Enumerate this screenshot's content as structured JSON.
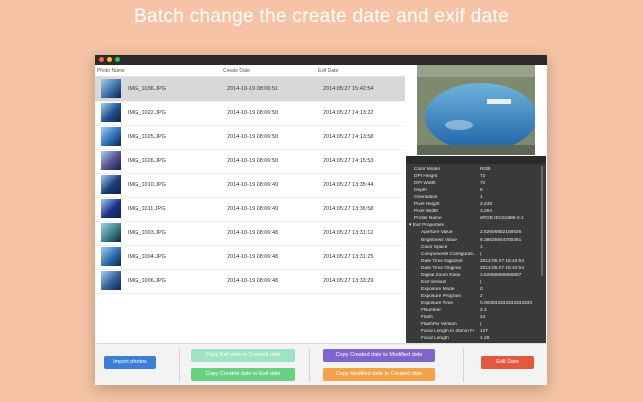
{
  "headline": "Batch change the create date and exif date",
  "table": {
    "headers": {
      "name": "Photo Name",
      "create": "Create Date",
      "exif": "Exif Date"
    },
    "rows": [
      {
        "name": "IMG_1036.JPG",
        "create": "2014-10-19 08:06:51",
        "exif": "2014:05:27 15:42:54",
        "thumb_color": "#3a6fa8"
      },
      {
        "name": "IMG_1022.JPG",
        "create": "2014-10-19 08:06:50",
        "exif": "2014:05:27 14:13:22",
        "thumb_color": "#1f4f8f"
      },
      {
        "name": "IMG_1025.JPG",
        "create": "2014-10-19 08:06:50",
        "exif": "2014:05:27 14:13:58",
        "thumb_color": "#2a70b8"
      },
      {
        "name": "IMG_1026.JPG",
        "create": "2014-10-19 08:06:50",
        "exif": "2014:05:27 14:15:53",
        "thumb_color": "#5a4e8f"
      },
      {
        "name": "IMG_1010.JPG",
        "create": "2014-10-19 08:06:49",
        "exif": "2014:05:27 13:35:44",
        "thumb_color": "#1a3c7a"
      },
      {
        "name": "IMG_1011.JPG",
        "create": "2014-10-19 08:06:49",
        "exif": "2014:05:27 13:36:58",
        "thumb_color": "#1b2f8c"
      },
      {
        "name": "IMG_1003.JPG",
        "create": "2014-10-19 08:06:48",
        "exif": "2014:05:27 13:31:12",
        "thumb_color": "#3b7f86"
      },
      {
        "name": "IMG_1004.JPG",
        "create": "2014-10-19 08:06:48",
        "exif": "2014:05:27 13:31:25",
        "thumb_color": "#2b6fae"
      },
      {
        "name": "IMG_1006.JPG",
        "create": "2014-10-19 08:06:48",
        "exif": "2014:05:27 13:33:29",
        "thumb_color": "#355f98"
      }
    ]
  },
  "props": [
    {
      "k": "Color Model",
      "v": "RGB",
      "indent": 0
    },
    {
      "k": "DPI Height",
      "v": "72",
      "indent": 0
    },
    {
      "k": "DPI Width",
      "v": "72",
      "indent": 0
    },
    {
      "k": "Depth",
      "v": "8",
      "indent": 0
    },
    {
      "k": "Orientation",
      "v": "1",
      "indent": 0
    },
    {
      "k": "Pixel Height",
      "v": "2,448",
      "indent": 0
    },
    {
      "k": "Pixel Width",
      "v": "3,264",
      "indent": 0
    },
    {
      "k": "Profile Name",
      "v": "sRGB IEC61966-2.1",
      "indent": 0
    },
    {
      "k": "▾ Exif Properties",
      "v": "",
      "indent": -1
    },
    {
      "k": "Aperture Value",
      "v": "2.52606882168926",
      "indent": 1
    },
    {
      "k": "Brightness Value",
      "v": "9.38635944700461",
      "indent": 1
    },
    {
      "k": "Color Space",
      "v": "1",
      "indent": 1
    },
    {
      "k": "Components Configurati...",
      "v": "(",
      "indent": 1
    },
    {
      "k": "Date Time Digitized",
      "v": "2014:05:27 15:42:54",
      "indent": 1
    },
    {
      "k": "Date Time Original",
      "v": "2014:05:27 15:42:54",
      "indent": 1
    },
    {
      "k": "Digital Zoom Ratio",
      "v": "3.62666666666667",
      "indent": 1
    },
    {
      "k": "Exif Version",
      "v": "(",
      "indent": 1
    },
    {
      "k": "Exposure Mode",
      "v": "0",
      "indent": 1
    },
    {
      "k": "Exposure Program",
      "v": "2",
      "indent": 1
    },
    {
      "k": "Exposure Time",
      "v": "0.000833333333333333",
      "indent": 1
    },
    {
      "k": "FNumber",
      "v": "2.4",
      "indent": 1
    },
    {
      "k": "Flash",
      "v": "24",
      "indent": 1
    },
    {
      "k": "FlashPix Version",
      "v": "(",
      "indent": 1
    },
    {
      "k": "Focal Length In 35mm Fi",
      "v": "127",
      "indent": 1
    },
    {
      "k": "Focal Length",
      "v": "4.28",
      "indent": 1
    }
  ],
  "buttons": {
    "import": "Import photos",
    "exif_to_created": "Copy Exif date to Created date",
    "created_to_exif": "Copy Created date to Exif date",
    "created_to_modified": "Copy Created date to Modified date",
    "modified_to_created": "Copy Modified date to Created date",
    "edit": "Edit Date"
  },
  "colors": {
    "background": "#f6c3a6",
    "import": "#3b7ed6",
    "exif_to_created": "#9fe2c6",
    "created_to_exif": "#67d181",
    "created_to_modified": "#7e65c9",
    "modified_to_created": "#f2a348",
    "edit": "#e2593f"
  }
}
